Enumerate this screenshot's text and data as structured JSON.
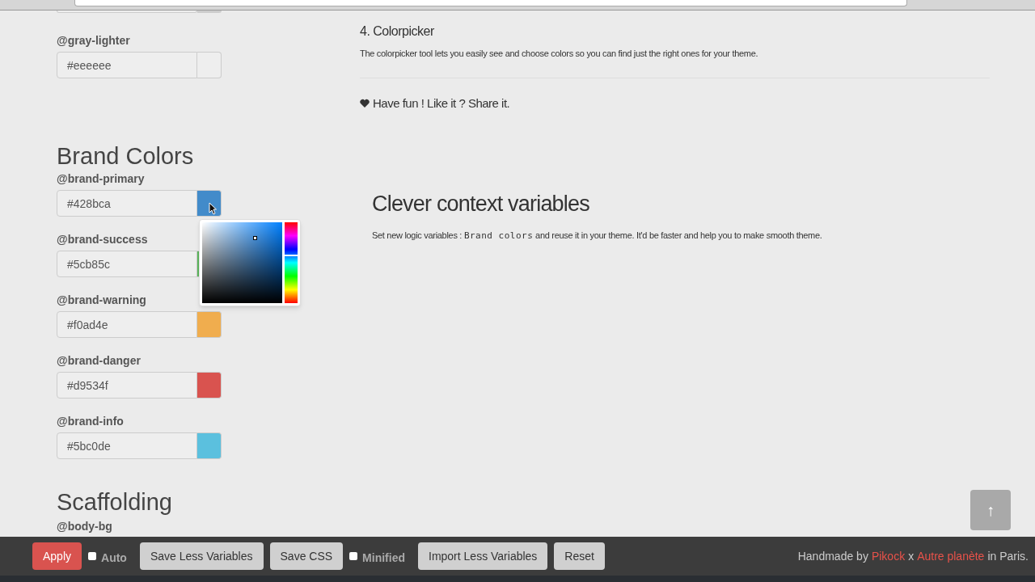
{
  "variables": [
    {
      "kind": "cut_field",
      "color": "#cccccc"
    },
    {
      "kind": "field",
      "label": "@gray-lighter",
      "value": "#eeeeee",
      "color": "#eeeeee",
      "picker_open": false
    },
    {
      "kind": "heading",
      "text": "Brand Colors"
    },
    {
      "kind": "field",
      "label": "@brand-primary",
      "value": "#428bca",
      "color": "#428bca",
      "picker_open": true
    },
    {
      "kind": "field",
      "label": "@brand-success",
      "value": "#5cb85c",
      "color": "#5cb85c",
      "picker_open": false
    },
    {
      "kind": "field",
      "label": "@brand-warning",
      "value": "#f0ad4e",
      "color": "#f0ad4e",
      "picker_open": false
    },
    {
      "kind": "field",
      "label": "@brand-danger",
      "value": "#d9534f",
      "color": "#d9534f",
      "picker_open": false
    },
    {
      "kind": "field",
      "label": "@brand-info",
      "value": "#5bc0de",
      "color": "#5bc0de",
      "picker_open": false
    },
    {
      "kind": "heading",
      "text": "Scaffolding"
    },
    {
      "kind": "label",
      "label": "@body-bg"
    }
  ],
  "features": [
    {
      "title": "4. Colorpicker",
      "text": "The colorpicker tool lets you easily see and choose colors so you can find just the right ones for your theme."
    }
  ],
  "share": {
    "text": "Have fun ! Like it ? Share it."
  },
  "context": {
    "title": "Clever context variables",
    "text_before": "Set new logic variables :",
    "code": "Brand colors",
    "text_after": "and reuse it in your theme. It'd be faster and help you to make smooth theme."
  },
  "back_to_top": {
    "label": "↑"
  },
  "toolbar": [
    {
      "kind": "button",
      "label": "Apply",
      "primary": true
    },
    {
      "kind": "checkbox",
      "label": "Auto",
      "checked": false
    },
    {
      "kind": "button",
      "label": "Save Less Variables",
      "primary": false
    },
    {
      "kind": "button",
      "label": "Save CSS",
      "primary": false
    },
    {
      "kind": "checkbox",
      "label": "Minified",
      "checked": false
    },
    {
      "kind": "button",
      "label": "Import Less Variables",
      "primary": false
    },
    {
      "kind": "button",
      "label": "Reset",
      "primary": false
    }
  ],
  "credit": {
    "before": "Handmade by",
    "author": "Pikock",
    "separator": "x",
    "studio": "Autre planète",
    "after": "in Paris."
  }
}
